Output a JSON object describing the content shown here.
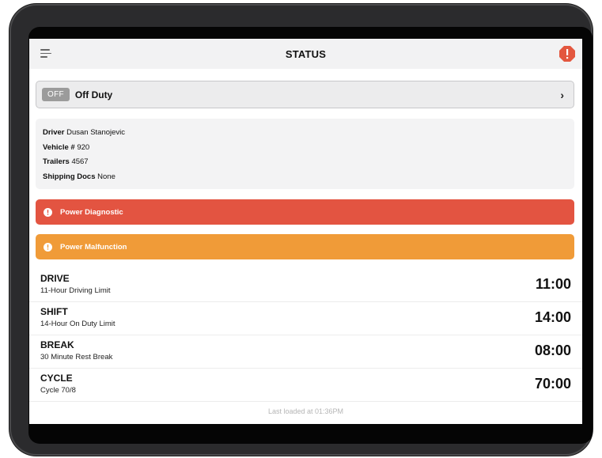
{
  "header": {
    "title": "STATUS",
    "menu_icon": "hamburger-menu-icon",
    "alert_icon": "alert-octagon-icon",
    "alert_color": "#e3573f"
  },
  "duty_status": {
    "badge": "OFF",
    "label": "Off Duty"
  },
  "info": {
    "driver_label": "Driver",
    "driver_value": "Dusan Stanojevic",
    "vehicle_label": "Vehicle #",
    "vehicle_value": "920",
    "trailers_label": "Trailers",
    "trailers_value": "4567",
    "docs_label": "Shipping Docs",
    "docs_value": "None"
  },
  "alerts": [
    {
      "label": "Power Diagnostic",
      "color": "#e35441"
    },
    {
      "label": "Power Malfunction",
      "color": "#f09b38"
    }
  ],
  "limits": [
    {
      "name": "DRIVE",
      "desc": "11-Hour Driving Limit",
      "time": "11:00"
    },
    {
      "name": "SHIFT",
      "desc": "14-Hour On Duty Limit",
      "time": "14:00"
    },
    {
      "name": "BREAK",
      "desc": "30 Minute Rest Break",
      "time": "08:00"
    },
    {
      "name": "CYCLE",
      "desc": "Cycle 70/8",
      "time": "70:00"
    }
  ],
  "footer": {
    "last_loaded": "Last loaded at 01:36PM"
  }
}
